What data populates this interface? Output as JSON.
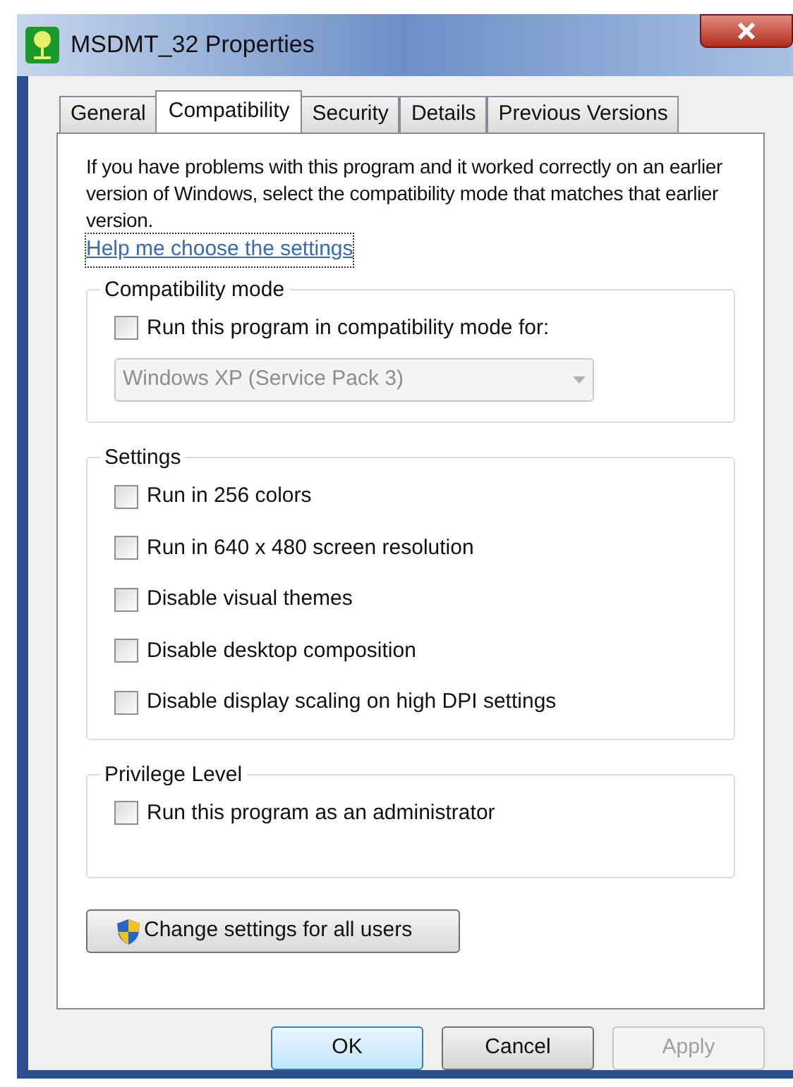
{
  "window": {
    "title": "MSDMT_32 Properties"
  },
  "tabs": [
    {
      "label": "General",
      "selected": false
    },
    {
      "label": "Compatibility",
      "selected": true
    },
    {
      "label": "Security",
      "selected": false
    },
    {
      "label": "Details",
      "selected": false
    },
    {
      "label": "Previous Versions",
      "selected": false
    }
  ],
  "description": "If you have problems with this program and it worked correctly on an earlier version of Windows, select the compatibility mode that matches that earlier version.",
  "help_link": "Help me choose the settings",
  "compatibility_mode": {
    "title": "Compatibility mode",
    "checkbox": {
      "label": "Run this program in compatibility mode for:",
      "checked": false
    },
    "dropdown": {
      "value": "Windows XP (Service Pack 3)",
      "disabled": true
    }
  },
  "settings": {
    "title": "Settings",
    "options": [
      {
        "label": "Run in 256 colors",
        "checked": false
      },
      {
        "label": "Run in 640 x 480 screen resolution",
        "checked": false
      },
      {
        "label": "Disable visual themes",
        "checked": false
      },
      {
        "label": "Disable desktop composition",
        "checked": false
      },
      {
        "label": "Disable display scaling on high DPI settings",
        "checked": false
      }
    ]
  },
  "privilege_level": {
    "title": "Privilege Level",
    "options": [
      {
        "label": "Run this program as an administrator",
        "checked": false
      }
    ]
  },
  "change_settings_button": "Change settings for all users",
  "buttons": [
    {
      "label": "OK",
      "default": true,
      "disabled": false
    },
    {
      "label": "Cancel",
      "default": false,
      "disabled": false
    },
    {
      "label": "Apply",
      "default": false,
      "disabled": true
    }
  ]
}
